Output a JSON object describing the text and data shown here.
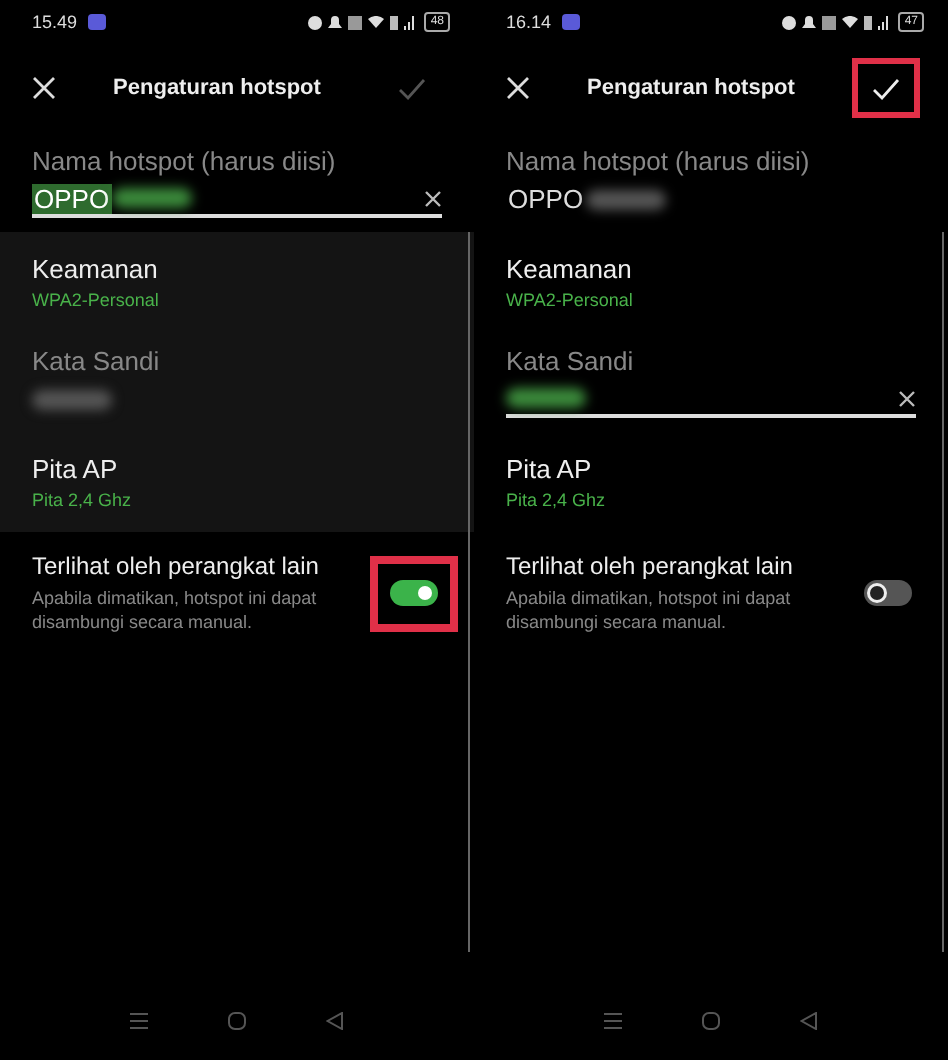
{
  "screens": [
    {
      "status_bar": {
        "time": "15.49",
        "battery": "48"
      },
      "header": {
        "title": "Pengaturan hotspot",
        "save_enabled": false,
        "save_highlighted": false
      },
      "rows": [
        {
          "kind": "field",
          "label": "Nama hotspot (harus diisi)",
          "value": "OPPO",
          "focused": true,
          "shaded": false
        },
        {
          "kind": "option",
          "title": "Keamanan",
          "value": "WPA2-Personal",
          "shaded": true
        },
        {
          "kind": "field",
          "label": "Kata Sandi",
          "value": "",
          "focused": false,
          "shaded": true
        },
        {
          "kind": "option",
          "title": "Pita AP",
          "value": "Pita 2,4 Ghz",
          "shaded": true
        },
        {
          "kind": "toggle",
          "title": "Terlihat oleh perangkat lain",
          "description": "Apabila dimatikan, hotspot ini dapat disambungi secara manual.",
          "on": true,
          "highlighted": true
        }
      ]
    },
    {
      "status_bar": {
        "time": "16.14",
        "battery": "47"
      },
      "header": {
        "title": "Pengaturan hotspot",
        "save_enabled": true,
        "save_highlighted": true
      },
      "rows": [
        {
          "kind": "field",
          "label": "Nama hotspot (harus diisi)",
          "value": "OPPO",
          "focused": false,
          "shaded": false
        },
        {
          "kind": "option",
          "title": "Keamanan",
          "value": "WPA2-Personal",
          "shaded": false
        },
        {
          "kind": "field",
          "label": "Kata Sandi",
          "value": "",
          "focused": true,
          "shaded": false
        },
        {
          "kind": "option",
          "title": "Pita AP",
          "value": "Pita 2,4 Ghz",
          "shaded": false
        },
        {
          "kind": "toggle",
          "title": "Terlihat oleh perangkat lain",
          "description": "Apabila dimatikan, hotspot ini dapat disambungi secara manual.",
          "on": false,
          "highlighted": false
        }
      ]
    }
  ]
}
